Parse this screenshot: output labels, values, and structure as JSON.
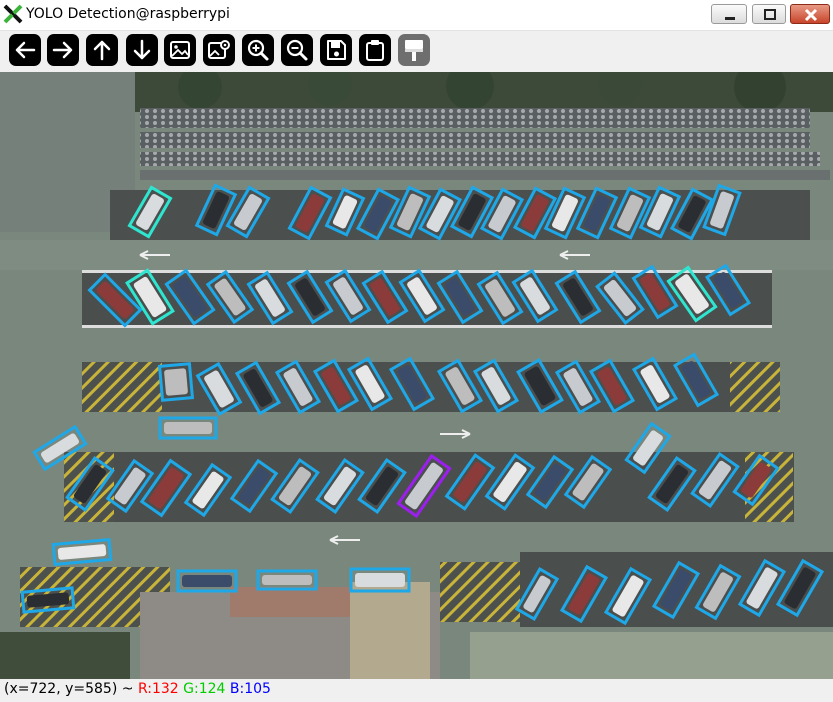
{
  "window": {
    "title": "YOLO Detection@raspberrypi",
    "controls": [
      "minimize",
      "maximize",
      "close"
    ]
  },
  "toolbar": {
    "tools": [
      {
        "name": "back",
        "icon": "arrow-left-icon"
      },
      {
        "name": "forward",
        "icon": "arrow-right-icon"
      },
      {
        "name": "up",
        "icon": "arrow-up-icon"
      },
      {
        "name": "down",
        "icon": "arrow-down-icon"
      },
      {
        "name": "image",
        "icon": "image-icon"
      },
      {
        "name": "image-edit",
        "icon": "image-settings-icon"
      },
      {
        "name": "zoom-in",
        "icon": "zoom-in-icon"
      },
      {
        "name": "zoom-out",
        "icon": "zoom-out-icon"
      },
      {
        "name": "save",
        "icon": "save-icon"
      },
      {
        "name": "copy",
        "icon": "clipboard-icon"
      },
      {
        "name": "paint",
        "icon": "brush-icon",
        "disabled": true
      }
    ]
  },
  "detection": {
    "box_colors": {
      "car": "#1fa8e8",
      "teal": "#2ee6d0",
      "selected": "#9c1ff0"
    },
    "selected_count": 1
  },
  "status": {
    "coords": "(x=722, y=585) ~",
    "r": "R:132",
    "g": "G:124",
    "b": "B:105",
    "colors": {
      "r": "#ff0000",
      "g": "#00cc00",
      "b": "#0000ff"
    }
  }
}
